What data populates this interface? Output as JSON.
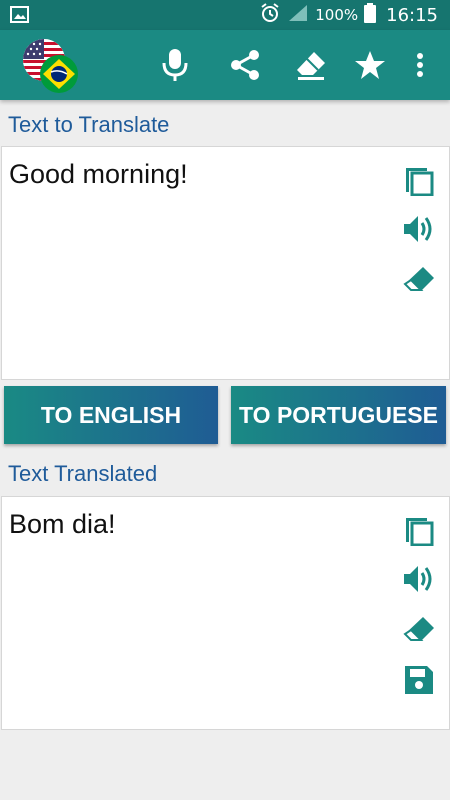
{
  "status_bar": {
    "battery_percent": "100%",
    "time": "16:15",
    "icons": [
      "image-notification-icon",
      "alarm-icon",
      "signal-icon",
      "battery-icon"
    ]
  },
  "toolbar": {
    "logo": "us-brazil-flags-logo",
    "actions": [
      "microphone-icon",
      "share-icon",
      "eraser-icon",
      "star-icon",
      "more-vert-icon"
    ]
  },
  "input_section": {
    "label": "Text to Translate",
    "text": "Good morning!",
    "icons": [
      "copy-icon",
      "speaker-icon",
      "eraser-icon"
    ]
  },
  "buttons": {
    "to_english": "TO ENGLISH",
    "to_portuguese": "TO PORTUGUESE"
  },
  "output_section": {
    "label": "Text Translated",
    "text": "Bom dia!",
    "icons": [
      "copy-icon",
      "speaker-icon",
      "eraser-icon",
      "save-icon"
    ]
  },
  "colors": {
    "status_bar": "#16756f",
    "toolbar": "#1b8a83",
    "label_blue": "#1f5b9a",
    "icon_teal": "#1b8a83"
  }
}
